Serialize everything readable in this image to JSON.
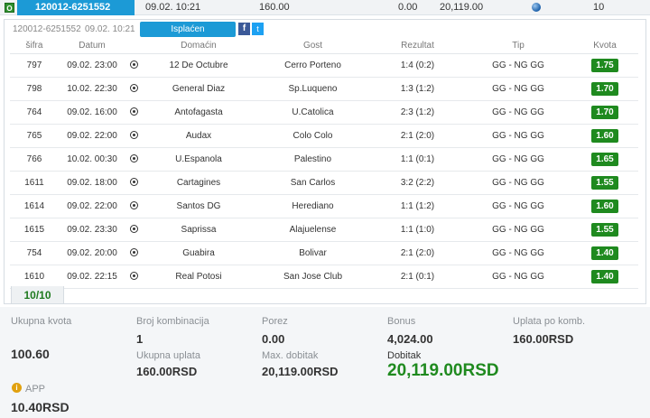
{
  "ticket": {
    "badge": "O",
    "id": "120012-6251552",
    "date": "09.02. 10:21",
    "stake": "160.00",
    "tax": "0.00",
    "payout": "20,119.00",
    "number": "10"
  },
  "panel": {
    "id": "120012-6251552",
    "date": "09.02. 10:21",
    "status_label": "Isplaćen",
    "facebook_label": "f",
    "twitter_label": "t"
  },
  "columns": [
    "šifra",
    "Datum",
    "",
    "Domaćin",
    "Gost",
    "Rezultat",
    "Tip",
    "Kvota"
  ],
  "matches": [
    {
      "code": "797",
      "date": "09.02. 23:00",
      "home": "12 De Octubre",
      "away": "Cerro Porteno",
      "result": "1:4 (0:2)",
      "tip": "GG - NG GG",
      "odds": "1.75"
    },
    {
      "code": "798",
      "date": "10.02. 22:30",
      "home": "General Diaz",
      "away": "Sp.Luqueno",
      "result": "1:3 (1:2)",
      "tip": "GG - NG GG",
      "odds": "1.70"
    },
    {
      "code": "764",
      "date": "09.02. 16:00",
      "home": "Antofagasta",
      "away": "U.Catolica",
      "result": "2:3 (1:2)",
      "tip": "GG - NG GG",
      "odds": "1.70"
    },
    {
      "code": "765",
      "date": "09.02. 22:00",
      "home": "Audax",
      "away": "Colo Colo",
      "result": "2:1 (2:0)",
      "tip": "GG - NG GG",
      "odds": "1.60"
    },
    {
      "code": "766",
      "date": "10.02. 00:30",
      "home": "U.Espanola",
      "away": "Palestino",
      "result": "1:1 (0:1)",
      "tip": "GG - NG GG",
      "odds": "1.65"
    },
    {
      "code": "1611",
      "date": "09.02. 18:00",
      "home": "Cartagines",
      "away": "San Carlos",
      "result": "3:2 (2:2)",
      "tip": "GG - NG GG",
      "odds": "1.55"
    },
    {
      "code": "1614",
      "date": "09.02. 22:00",
      "home": "Santos DG",
      "away": "Herediano",
      "result": "1:1 (1:2)",
      "tip": "GG - NG GG",
      "odds": "1.60"
    },
    {
      "code": "1615",
      "date": "09.02. 23:30",
      "home": "Saprissa",
      "away": "Alajuelense",
      "result": "1:1 (1:0)",
      "tip": "GG - NG GG",
      "odds": "1.55"
    },
    {
      "code": "754",
      "date": "09.02. 20:00",
      "home": "Guabira",
      "away": "Bolivar",
      "result": "2:1 (2:0)",
      "tip": "GG - NG GG",
      "odds": "1.40"
    },
    {
      "code": "1610",
      "date": "09.02. 22:15",
      "home": "Real Potosi",
      "away": "San Jose Club",
      "result": "2:1 (0:1)",
      "tip": "GG - NG GG",
      "odds": "1.40"
    }
  ],
  "count_label": "10/10",
  "summary": {
    "total_odds_label": "Ukupna kvota",
    "total_odds": "100.60",
    "app_label": "APP",
    "app_value": "10.40RSD",
    "combinations_label": "Broj kombinacija",
    "combinations": "1",
    "total_stake_label": "Ukupna uplata",
    "total_stake": "160.00RSD",
    "tax_label": "Porez",
    "tax": "0.00",
    "max_win_label": "Max. dobitak",
    "max_win": "20,119.00RSD",
    "bonus_label": "Bonus",
    "bonus": "4,024.00",
    "win_label": "Dobitak",
    "win": "20,119.00RSD",
    "per_comb_label": "Uplata po komb.",
    "per_comb": "160.00RSD"
  },
  "colors": {
    "accent": "#1c9ad6",
    "odds_green": "#1f8a1f",
    "win_green": "#1f8a1f"
  }
}
